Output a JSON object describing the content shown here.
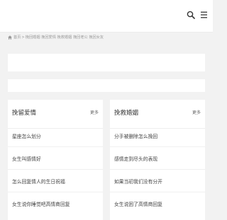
{
  "header": {
    "search_icon": "search-icon",
    "menu_icon": "menu-icon"
  },
  "breadcrumb": {
    "home_icon": "home-icon",
    "home": "首页",
    "separator": ">",
    "path": "挽回婚姻 挽回爱情 挽救婚姻 挽回老公 挽回女友"
  },
  "left_column": {
    "title": "挽留爱情",
    "more": "更多",
    "items": [
      "星座怎么划分",
      "女生叫感情好",
      "怎么回复情人的生日祝福",
      "女生说你睡觉吧高情商回复"
    ]
  },
  "right_column": {
    "title": "挽救婚姻",
    "more": "更多",
    "items": [
      "分手被删除怎么挽回",
      "感情走到尽头的表现",
      "如果当初我们没有分开",
      "女生说困了高情商回复"
    ]
  },
  "colors": {
    "background": "#f2f2f2",
    "panel": "#ffffff",
    "text": "#333333",
    "muted": "#999999"
  }
}
